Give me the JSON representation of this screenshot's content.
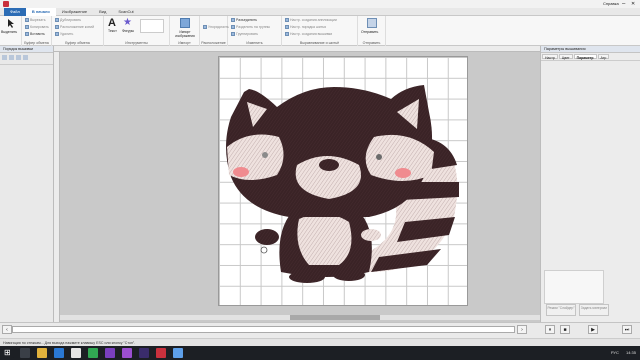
{
  "window": {
    "title": "Brother PE-DESIGN",
    "help": "Справка"
  },
  "tabs": [
    "Файл",
    "В начало",
    "Изображение",
    "Вид",
    "ScanCut"
  ],
  "active_tab": "В начало",
  "ribbon": {
    "select_label": "Выделить",
    "group_clipboard": "Буфер обмена",
    "clipboard_items": [
      "Вырезать",
      "Копировать",
      "Вставить"
    ],
    "group_clipboard2": "Буфер обмена",
    "clip2_items": [
      "Дублировать",
      "Расположение копий",
      "Удалить"
    ],
    "group_tools": "Инструменты",
    "text_label": "Текст",
    "patterns_label": "Фигуры",
    "group_import": "Импорт",
    "import_label": "Импорт изображения",
    "group_arrange": "Расположение",
    "arrange_items": [
      "Упорядочить"
    ],
    "group_edit": "Изменить",
    "edit_items": [
      "Разъединить",
      "Разделить на группы",
      "Группировать"
    ],
    "group_stitch": "Выравнивание и шитьё",
    "stitch_items": [
      "Настр. создания аппликации",
      "Настр. порядка шитья",
      "Настр. создания вышивки"
    ],
    "group_send": "Отправить",
    "send_label": "Отправить"
  },
  "left_panel": {
    "title": "Порядок вышивки"
  },
  "right_panel": {
    "title": "Параметры вышивания",
    "tabs": [
      "Настр",
      "Цвет",
      "Параметр",
      "Атр"
    ],
    "buttons": [
      "Режим \"Слайдер\"",
      "Задать материал"
    ]
  },
  "status": {
    "text": "Навигация по стежкам... Для выхода нажмите клавишу ESC или кнопку \"Стоп\"."
  },
  "tray": {
    "lang": "РУС",
    "time": "14:35"
  },
  "colors": {
    "accent": "#2b6cb5",
    "thread_dark": "#3a2326",
    "thread_light": "#ead8d6",
    "blush": "#f08b8f"
  },
  "icons": [
    "select-icon",
    "cut-icon",
    "copy-icon",
    "paste-icon",
    "text-icon",
    "shapes-icon",
    "import-icon",
    "send-icon",
    "stop-icon",
    "play-icon",
    "next-icon"
  ]
}
